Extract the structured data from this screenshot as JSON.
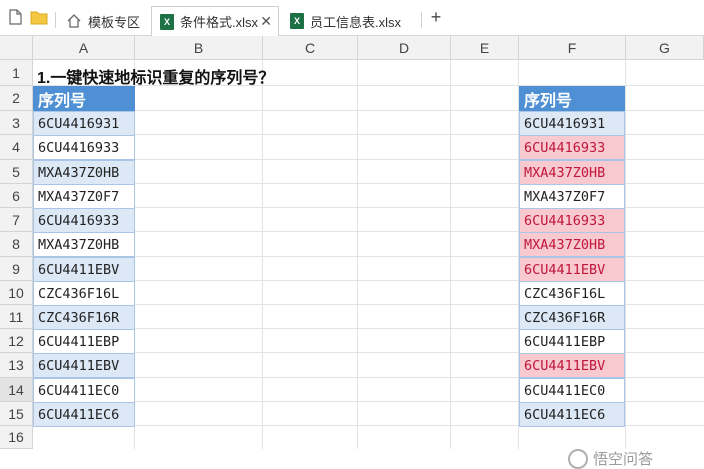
{
  "tabs": [
    {
      "label": "模板专区",
      "icon": "home-icon"
    },
    {
      "label": "条件格式.xlsx",
      "icon": "excel-icon",
      "active": true
    },
    {
      "label": "员工信息表.xlsx",
      "icon": "excel-icon"
    }
  ],
  "icons": {
    "xls_letter": "X",
    "close": "✕",
    "add": "+"
  },
  "columns": [
    "A",
    "B",
    "C",
    "D",
    "E",
    "F",
    "G"
  ],
  "rows": [
    "1",
    "2",
    "3",
    "4",
    "5",
    "6",
    "7",
    "8",
    "9",
    "10",
    "11",
    "12",
    "13",
    "14",
    "15",
    "16"
  ],
  "selected_row": "14",
  "sheet": {
    "title": "1.一键快速地标识重复的序列号？",
    "header": "序列号",
    "colA": [
      "6CU4416931",
      "6CU4416933",
      "MXA437Z0HB",
      "MXA437Z0F7",
      "6CU4416933",
      "MXA437Z0HB",
      "6CU4411EBV",
      "CZC436F16L",
      "CZC436F16R",
      "6CU4411EBP",
      "6CU4411EBV",
      "6CU4411EC0",
      "6CU4411EC6"
    ],
    "colF": [
      "6CU4416931",
      "6CU4416933",
      "MXA437Z0HB",
      "MXA437Z0F7",
      "6CU4416933",
      "MXA437Z0HB",
      "6CU4411EBV",
      "CZC436F16L",
      "CZC436F16R",
      "6CU4411EBP",
      "6CU4411EBV",
      "6CU4411EC0",
      "6CU4411EC6"
    ],
    "colF_duplicate": [
      false,
      true,
      true,
      false,
      true,
      true,
      true,
      false,
      false,
      false,
      true,
      false,
      false
    ]
  },
  "watermark": "悟空问答",
  "colors": {
    "header_fill": "#4f8fd3",
    "band_fill": "#dce8f5",
    "duplicate_fill": "#f8c9cf",
    "duplicate_text": "#c0163a"
  }
}
